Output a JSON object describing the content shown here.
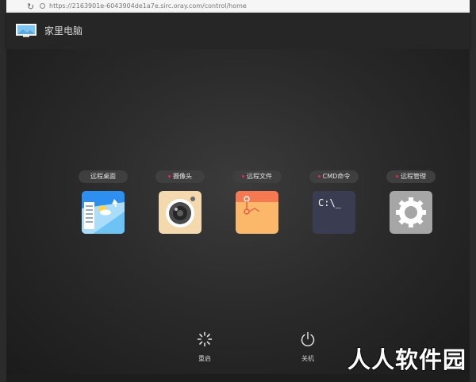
{
  "browser": {
    "url": "https://2163901e-6043904de1a7e.sirc.oray.com/control/home"
  },
  "header": {
    "title": "家里电脑",
    "icon": "monitor-icon"
  },
  "apps": [
    {
      "label": "远程桌面",
      "icon": "remote-desktop-icon",
      "dot": false
    },
    {
      "label": "摄像头",
      "icon": "camera-icon",
      "dot": true
    },
    {
      "label": "远程文件",
      "icon": "remote-files-icon",
      "dot": true
    },
    {
      "label": "CMD命令",
      "icon": "cmd-icon",
      "dot": true,
      "tile_text": "C:\\_"
    },
    {
      "label": "远程管理",
      "icon": "gear-icon",
      "dot": true
    }
  ],
  "actions": {
    "restart": {
      "label": "重启",
      "icon": "restart-spinner-icon"
    },
    "shutdown": {
      "label": "关机",
      "icon": "power-icon"
    }
  },
  "watermark": "人人软件园",
  "colors": {
    "dot": "#e8284d",
    "desktop_tile": "#2d8ff0",
    "camera_tile": "#f4d9ae",
    "files_tile": "#fbb86a",
    "cmd_tile": "#3a3d52",
    "manage_tile": "#a6a6a6"
  }
}
